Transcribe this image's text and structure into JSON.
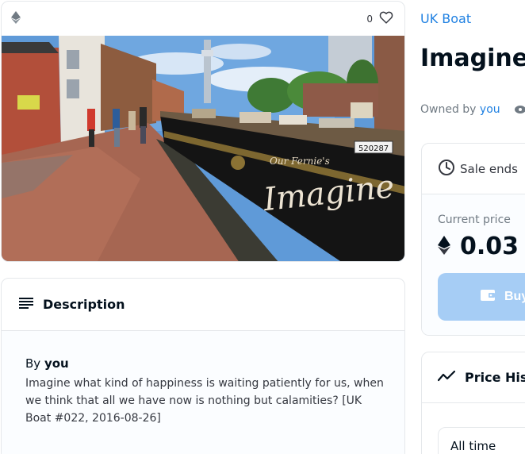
{
  "media": {
    "like_count": "0",
    "icons": {
      "chain": "ethereum-icon",
      "favorite": "heart-icon"
    }
  },
  "description": {
    "title": "Description",
    "by_prefix": "By",
    "by_owner": "you",
    "text": "Imagine what kind of happiness is waiting patiently for us, when we think that all we have now is nothing but calamities? [UK Boat #022, 2016-08-26]"
  },
  "item": {
    "collection": "UK Boat",
    "title": "Imagine",
    "owned_by_label": "Owned by",
    "owner": "you"
  },
  "sale": {
    "sale_ends_label": "Sale ends",
    "current_price_label": "Current price",
    "price": "0.03",
    "usd": "(",
    "buy_label": "Buy now"
  },
  "history": {
    "title": "Price History",
    "range": "All time"
  },
  "colors": {
    "accent": "#2081e2",
    "button_disabled": "#a6cdf5",
    "border": "#e5e8eb",
    "text": "#04111d",
    "muted": "#707a83"
  }
}
